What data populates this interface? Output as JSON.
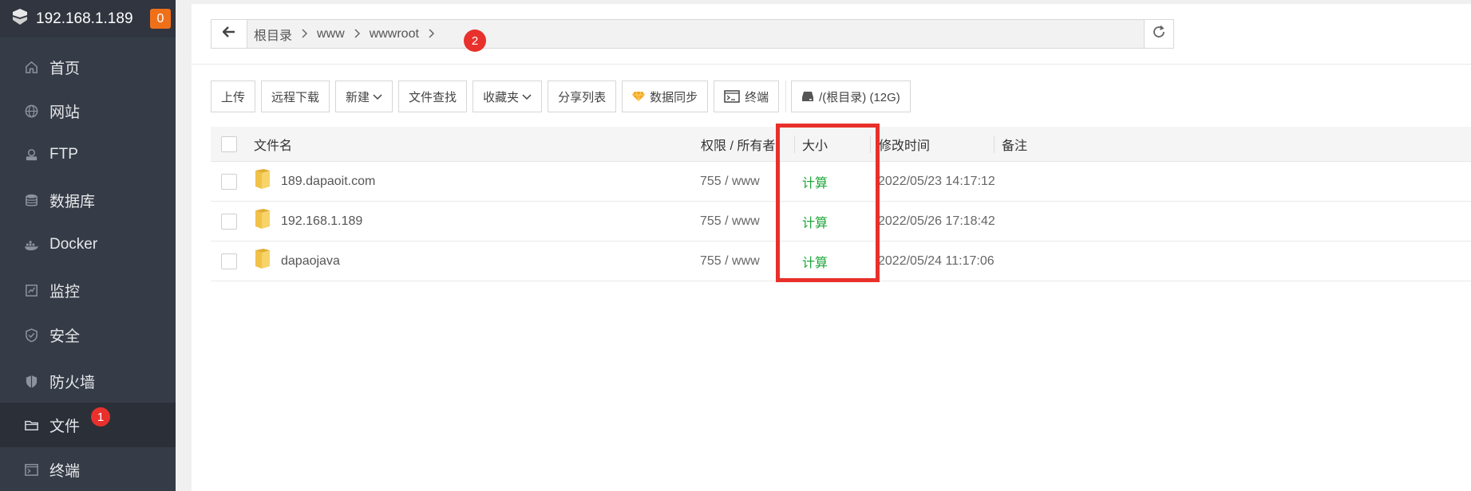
{
  "sidebar": {
    "brand": {
      "title": "192.168.1.189",
      "badge": "0"
    },
    "items": [
      {
        "label": "首页",
        "icon": "home-icon"
      },
      {
        "label": "网站",
        "icon": "globe-icon"
      },
      {
        "label": "FTP",
        "icon": "ftp-icon"
      },
      {
        "label": "数据库",
        "icon": "database-icon"
      },
      {
        "label": "Docker",
        "icon": "docker-icon"
      },
      {
        "label": "监控",
        "icon": "monitor-icon"
      },
      {
        "label": "安全",
        "icon": "shield-icon"
      },
      {
        "label": "防火墙",
        "icon": "firewall-icon"
      },
      {
        "label": "文件",
        "icon": "folder-icon",
        "active": true,
        "badge": "1"
      },
      {
        "label": "终端",
        "icon": "terminal-icon"
      }
    ]
  },
  "pathbar": {
    "crumbs": [
      "根目录",
      "www",
      "wwwroot"
    ],
    "badge": "2"
  },
  "toolbar": {
    "upload": "上传",
    "remote_download": "远程下载",
    "new": "新建",
    "file_search": "文件查找",
    "favorites": "收藏夹",
    "share_list": "分享列表",
    "data_sync": "数据同步",
    "terminal": "终端",
    "disk": "/(根目录) (12G)"
  },
  "table": {
    "headers": {
      "name": "文件名",
      "perm": "权限 / 所有者",
      "size": "大小",
      "mtime": "修改时间",
      "note": "备注"
    },
    "rows": [
      {
        "name": "189.dapaoit.com",
        "perm": "755 / www",
        "size": "计算",
        "mtime": "2022/05/23 14:17:12"
      },
      {
        "name": "192.168.1.189",
        "perm": "755 / www",
        "size": "计算",
        "mtime": "2022/05/26 17:18:42"
      },
      {
        "name": "dapaojava",
        "perm": "755 / www",
        "size": "计算",
        "mtime": "2022/05/24 11:17:06"
      }
    ]
  },
  "colors": {
    "sidebar_bg": "#363c47",
    "accent_green": "#20a53a",
    "badge_red": "#e8312c",
    "badge_orange": "#f0701a"
  }
}
